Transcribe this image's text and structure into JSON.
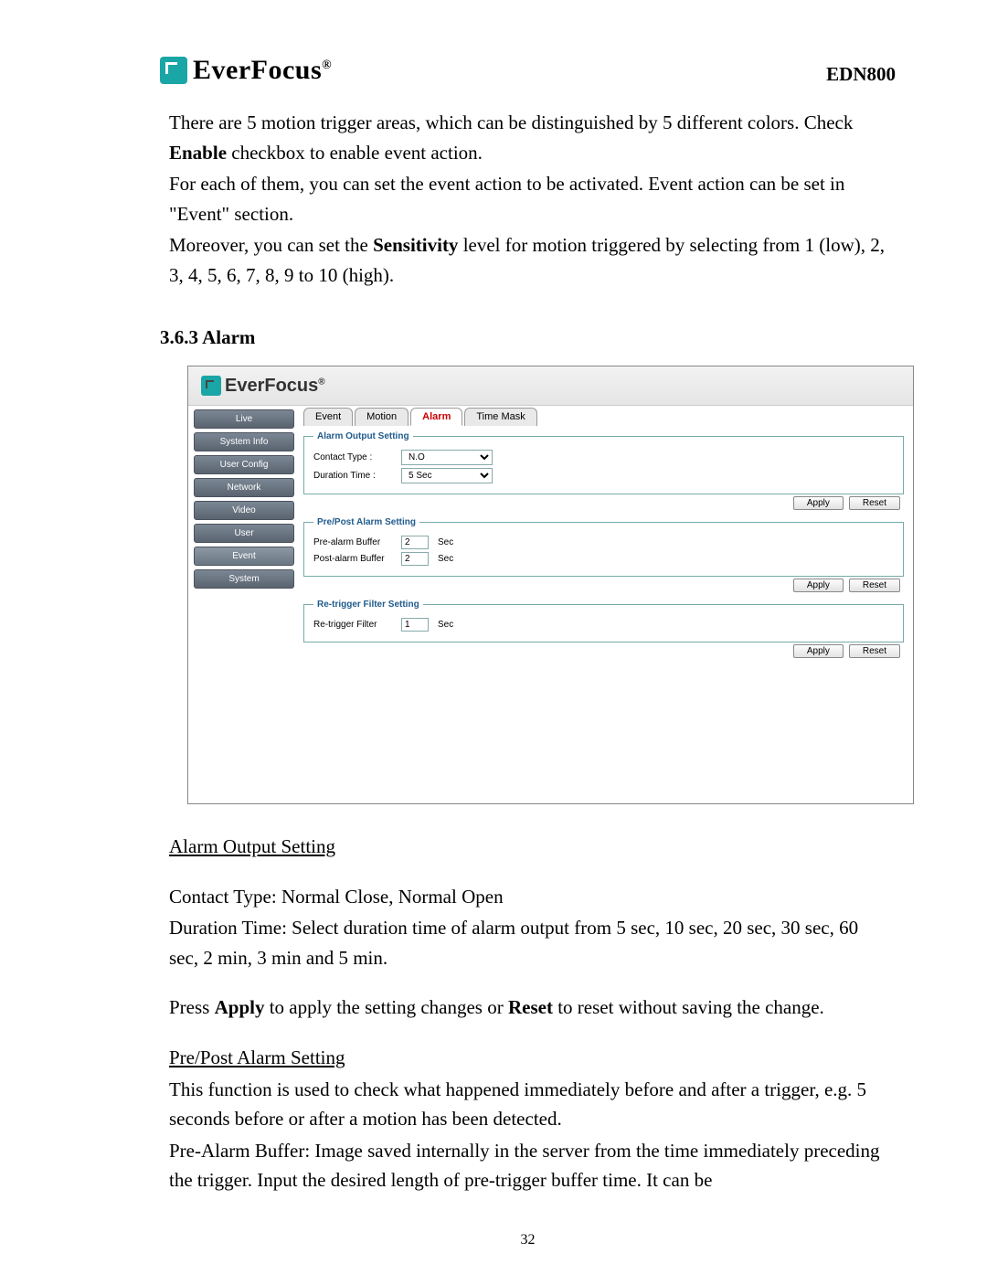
{
  "header": {
    "brand": "EverFocus",
    "reg": "®",
    "model": "EDN800"
  },
  "intro": {
    "p1a": "There are 5 motion trigger areas, which can be distinguished by 5 different colors. Check ",
    "p1b_bold": "Enable",
    "p1c": " checkbox to enable event action.",
    "p2": "For each of them, you can set the event action to be activated. Event action can be set in \"Event\" section.",
    "p3a": "Moreover, you can set the ",
    "p3b_bold": "Sensitivity",
    "p3c": " level for motion triggered by selecting from 1 (low), 2, 3, 4, 5, 6, 7, 8, 9 to 10 (high)."
  },
  "section_title": "3.6.3 Alarm",
  "app": {
    "brand": "EverFocus",
    "reg": "®",
    "sidebar": [
      "Live",
      "System Info",
      "User Config",
      "Network",
      "Video",
      "User",
      "Event",
      "System"
    ],
    "active_side": "Event",
    "tabs": [
      "Event",
      "Motion",
      "Alarm",
      "Time Mask"
    ],
    "active_tab": "Alarm",
    "fs1": {
      "legend": "Alarm Output Setting",
      "contact_label": "Contact Type :",
      "contact_value": "N.O",
      "duration_label": "Duration Time :",
      "duration_value": "5 Sec"
    },
    "fs2": {
      "legend": "Pre/Post Alarm Setting",
      "pre_label": "Pre-alarm Buffer",
      "pre_value": "2",
      "post_label": "Post-alarm Buffer",
      "post_value": "2",
      "unit": "Sec"
    },
    "fs3": {
      "legend": "Re-trigger Filter Setting",
      "label": "Re-trigger Filter",
      "value": "1",
      "unit": "Sec"
    },
    "apply": "Apply",
    "reset": "Reset"
  },
  "below": {
    "h1": "Alarm Output Setting",
    "p1": "Contact Type: Normal Close, Normal Open",
    "p2": "Duration Time: Select duration time of alarm output from 5 sec, 10 sec, 20 sec, 30 sec, 60 sec, 2 min, 3 min and 5 min.",
    "p3a": "Press ",
    "p3b_bold": "Apply",
    "p3c": " to apply the setting changes or ",
    "p3d_bold": "Reset",
    "p3e": " to reset without saving the change.",
    "h2": "Pre/Post Alarm Setting",
    "p4": "This function is used to check what happened immediately before and after a trigger, e.g. 5 seconds before or after a motion has been detected.",
    "p5": "Pre-Alarm Buffer: Image saved internally in the server from the time immediately preceding the trigger. Input the desired length of pre-trigger buffer time. It can be"
  },
  "page_number": "32"
}
